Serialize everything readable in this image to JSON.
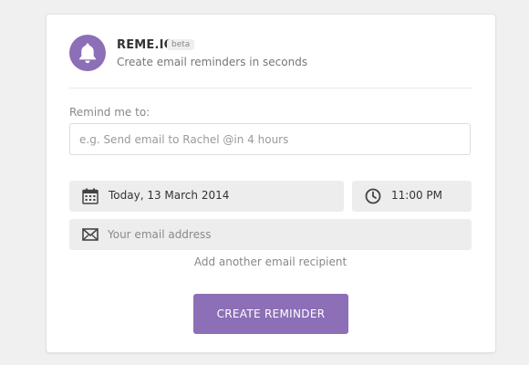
{
  "app": {
    "name": "REME.IO",
    "badge": "beta",
    "tagline": "Create email reminders in seconds",
    "logo_icon": "bell-icon",
    "accent_color": "#8c6fb7"
  },
  "form": {
    "remind_label": "Remind me to:",
    "remind_placeholder": "e.g. Send email to Rachel @in 4 hours",
    "remind_value": "",
    "date": {
      "icon": "calendar-icon",
      "value": "Today, 13 March 2014"
    },
    "time": {
      "icon": "clock-icon",
      "value": "11:00 PM"
    },
    "email": {
      "icon": "envelope-icon",
      "placeholder": "Your email address",
      "value": ""
    },
    "add_recipient_label": "Add another email recipient",
    "submit_label": "CREATE REMINDER"
  }
}
